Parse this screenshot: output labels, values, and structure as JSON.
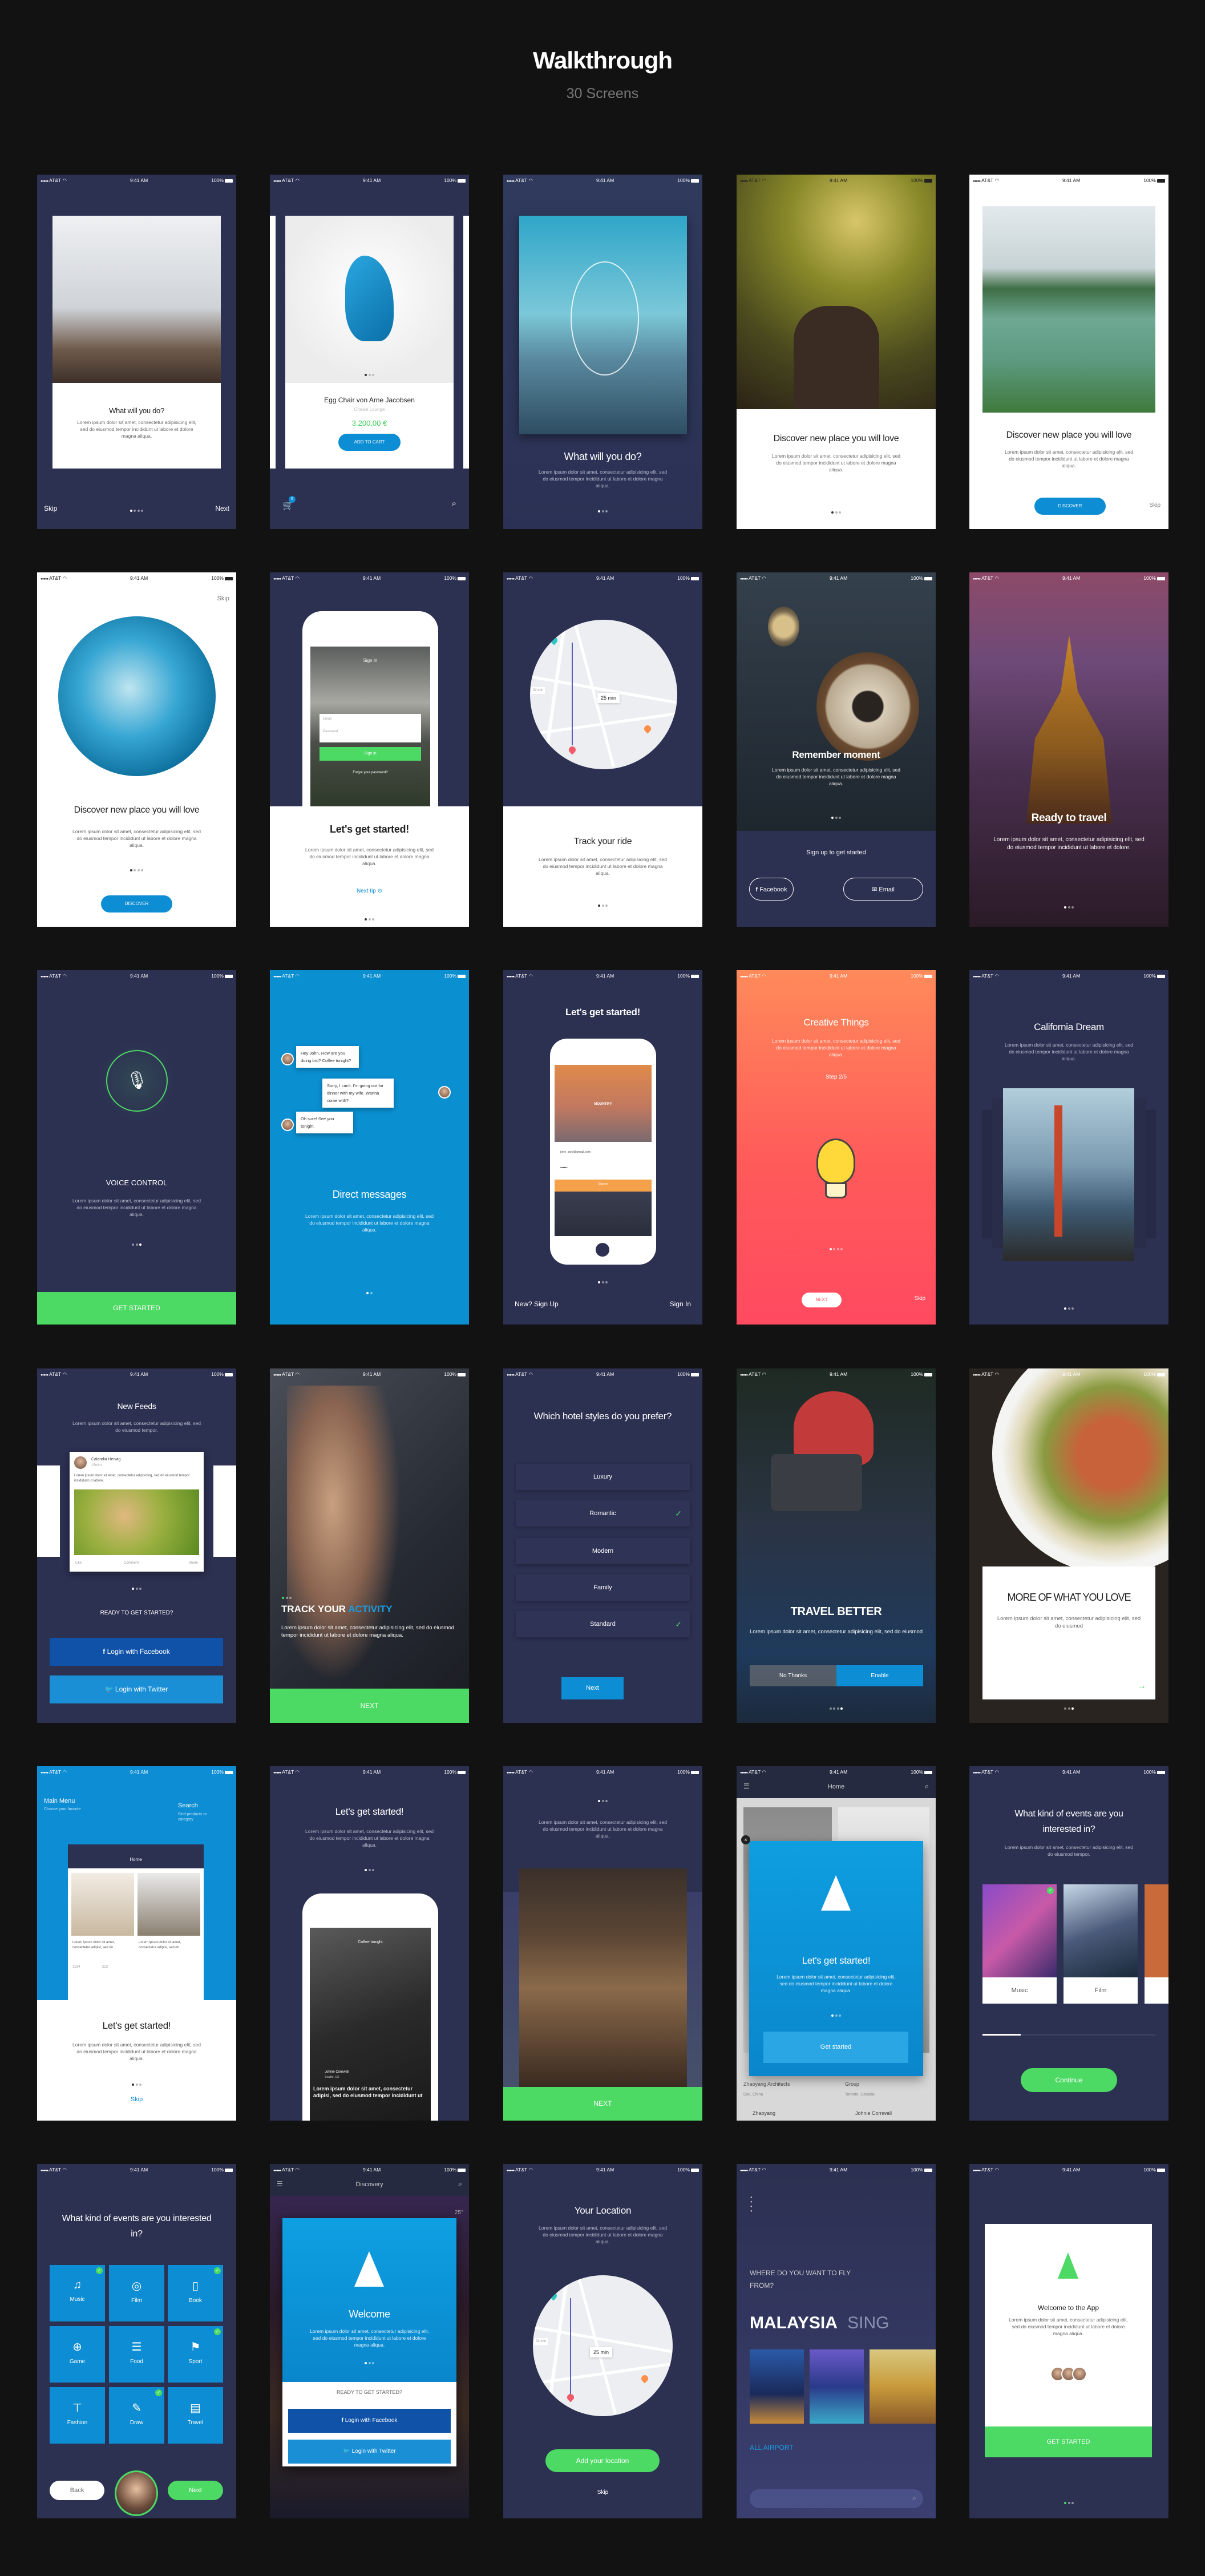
{
  "page": {
    "title": "Walkthrough",
    "subtitle": "30 Screens"
  },
  "status": {
    "carrier": "AT&T",
    "time": "9:41 AM",
    "battery": "100%"
  },
  "colors": {
    "navy": "#2c3051",
    "blue": "#0d8dd3",
    "green": "#4cd964",
    "facebook": "#0f52a8",
    "twitter": "#1a8fd6",
    "orange": "#ff8a5c",
    "red": "#ff4a5e"
  },
  "lorem": {
    "long": "Lorem ipsum dolor sit amet, consectetur adipisicing elit, sed do eiusmod tempor incididunt ut labore et dolore magna aliqua.",
    "dolore": "Lorem ipsum dolor sit amet, consectetur adipisicing elit, sed do eiusmod tempor incididunt ut labore et dolore.",
    "tempor": "Lorem ipsum dolor sit amet, consectetur adipisicing elit, sed do eiusmod tempor.",
    "eiusmod": "Lorem ipsum dolor sit amet, consectetur adipisicing elit, sed do eiusmod"
  },
  "s1": {
    "title": "What will you do?",
    "skip": "Skip",
    "next": "Next"
  },
  "s2": {
    "product": "Egg Chair von Arne Jacobsen",
    "category": "Chaise Lounge",
    "price": "3.200,00 €",
    "cta": "ADD TO CART",
    "cart_count": "5"
  },
  "s3": {
    "title": "What will you do?"
  },
  "s4": {
    "title": "Discover new place you will love"
  },
  "s5": {
    "title": "Discover new place you will love",
    "cta": "DISCOVER",
    "skip": "Skip"
  },
  "s6": {
    "title": "Discover new place you will love",
    "cta": "DISCOVER",
    "skip": "Skip"
  },
  "s7": {
    "title": "Let's get started!",
    "next_tip": "Next tip",
    "mock_title": "Sign In",
    "email": "Email",
    "password": "Password",
    "sign_in": "Sign in",
    "forgot": "Forgot your password?"
  },
  "s8": {
    "title": "Track your ride",
    "eta": "25 min",
    "eta2": "32 min"
  },
  "s9": {
    "title": "Remember moment",
    "signup": "Sign up to get started",
    "facebook": "Facebook",
    "email": "Email"
  },
  "s10": {
    "title": "Ready to travel"
  },
  "s11": {
    "title": "VOICE CONTROL",
    "cta": "GET STARTED"
  },
  "s12": {
    "title": "Direct messages",
    "messages": [
      "Hey John, How are you doing bro? Coffee tonight?",
      "Sorry, I can't. I'm going out for dinner with my wife. Wanna come with?",
      "Oh sure! See you tonight."
    ]
  },
  "s13": {
    "title": "Let's get started!",
    "signup": "New? Sign Up",
    "signin": "Sign In",
    "brand": "MOUNTIFY",
    "email_value": "john_doe@gmail.com",
    "password_value": "••••••",
    "sign_in": "Sign in"
  },
  "s14": {
    "title": "Creative Things",
    "step": "Step 2/5",
    "cta": "NEXT",
    "skip": "Skip"
  },
  "s15": {
    "title": "California Dream"
  },
  "s16": {
    "title": "New Feeds",
    "author": "Calandia Herwig",
    "time": "15mins",
    "post": "Lorem ipsum dolor sit amet, consectetur adipisicing, sed do eiusmod tempor incididunt ut labore.",
    "like": "Like",
    "comment": "Comment",
    "share": "Share",
    "ready": "READY TO GET STARTED?",
    "facebook": "Login with Facebook",
    "twitter": "Login with Twitter"
  },
  "s17": {
    "title_a": "TRACK YOUR ",
    "title_b": "ACTIVITY",
    "cta": "NEXT"
  },
  "s18": {
    "title": "Which hotel styles do you prefer?",
    "options": [
      {
        "label": "Luxury",
        "checked": false
      },
      {
        "label": "Romantic",
        "checked": true
      },
      {
        "label": "Modern",
        "checked": false
      },
      {
        "label": "Family",
        "checked": false
      },
      {
        "label": "Standard",
        "checked": true
      }
    ],
    "cta": "Next"
  },
  "s19": {
    "title": "TRAVEL BETTER",
    "no": "No Thanks",
    "yes": "Enable"
  },
  "s20": {
    "title": "MORE OF WHAT YOU LOVE"
  },
  "s21": {
    "menu": "Main Menu",
    "menu_sub": "Choose your favorite",
    "search": "Search",
    "search_sub": "Find products or category",
    "home": "Home",
    "card_text": "Lorem ipsum dolor sit amet, consectetur adipisi, sed do",
    "likes": "1234",
    "comments": "223",
    "title": "Let's get started!",
    "skip": "Skip"
  },
  "s22": {
    "title": "Let's get started!",
    "mock_title": "Coffee tonight",
    "author": "Johnie Cornwall",
    "location": "Seattle, US",
    "mock_text": "Lorem ipsum dolor sit amet, consectetur adipisi, sed do eiusmod tempor incididunt ut"
  },
  "s23": {
    "cta": "NEXT"
  },
  "s24": {
    "home": "Home",
    "title": "Let's get started!",
    "cta": "Get started",
    "bg_items": [
      "Zhaoyang Architects",
      "Group",
      "Dali, China",
      "Toronto, Canada",
      "Zhaoyang",
      "Johnie Cornwall"
    ]
  },
  "s25": {
    "title": "What kind of events are you interested in?",
    "cards": [
      "Music",
      "Film"
    ],
    "progress": 0.22,
    "cta": "Continue"
  },
  "s26": {
    "title": "What kind of events are you interested in?",
    "tiles": [
      {
        "label": "Music",
        "checked": true
      },
      {
        "label": "Film",
        "checked": false
      },
      {
        "label": "Book",
        "checked": true
      },
      {
        "label": "Game",
        "checked": false
      },
      {
        "label": "Food",
        "checked": false
      },
      {
        "label": "Sport",
        "checked": true
      },
      {
        "label": "Fashion",
        "checked": false
      },
      {
        "label": "Draw",
        "checked": true
      },
      {
        "label": "Travel",
        "checked": false
      }
    ],
    "back": "Back",
    "next": "Next"
  },
  "s27": {
    "header": "Discovery",
    "title": "Welcome",
    "temp": "25°",
    "ready": "READY TO GET STARTED?",
    "facebook": "Login with Facebook",
    "twitter": "Login with Twitter"
  },
  "s28": {
    "title": "Your Location",
    "eta": "25 min",
    "eta2": "32 min",
    "cta": "Add your location",
    "skip": "Skip"
  },
  "s29": {
    "question": "WHERE DO YOU WANT TO FLY FROM?",
    "country": "MALAYSIA",
    "next_country": "SING",
    "all": "ALL AIRPORT"
  },
  "s30": {
    "title": "Welcome to the App",
    "cta": "GET STARTED"
  }
}
